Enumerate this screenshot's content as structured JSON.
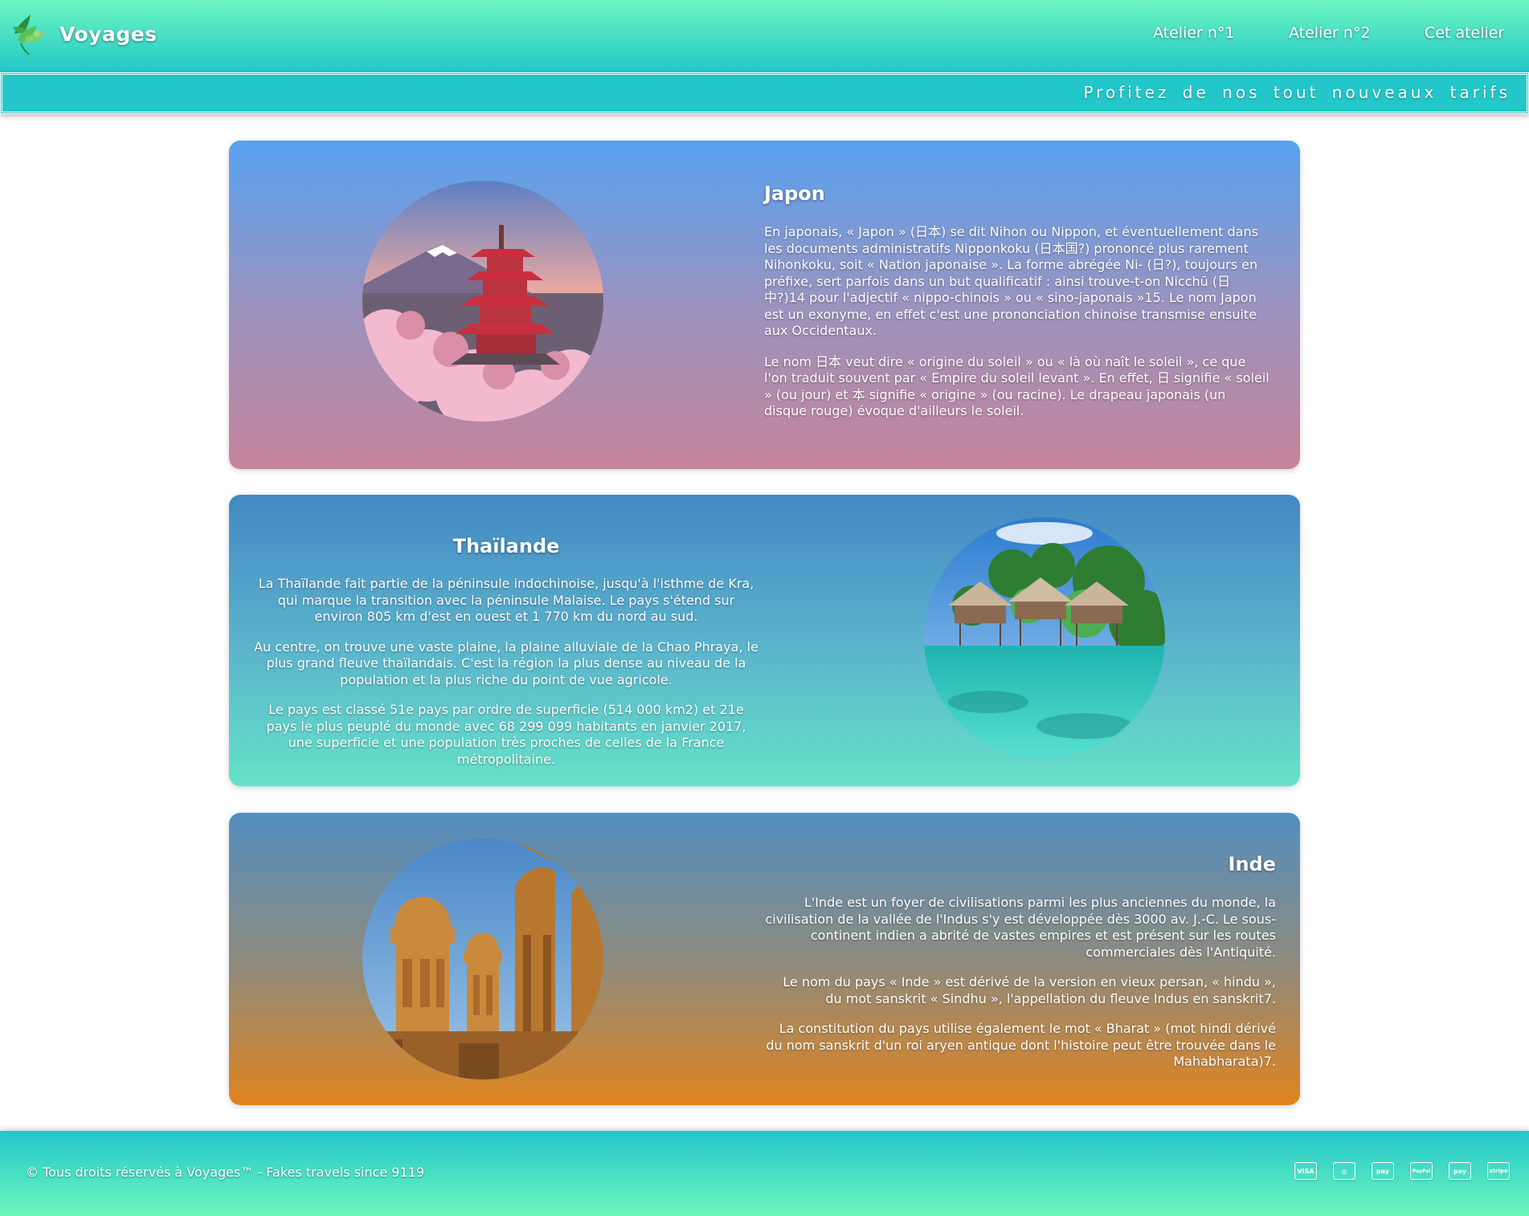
{
  "header": {
    "brand": "Voyages",
    "nav": [
      {
        "label": "Atelier n°1"
      },
      {
        "label": "Atelier n°2"
      },
      {
        "label": "Cet atelier"
      }
    ]
  },
  "banner": {
    "text": "Profitez de nos tout nouveaux tarifs"
  },
  "cards": [
    {
      "title": "Japon",
      "paragraphs": [
        "En japonais, « Japon » (日本) se dit Nihon ou Nippon, et éventuellement dans les documents administratifs Nipponkoku (日本国?) prononcé plus rarement Nihonkoku, soit « Nation japonaise ». La forme abrégée Ni- (日?), toujours en préfixe, sert parfois dans un but qualificatif : ainsi trouve-t-on Nicchū (日中?)14 pour l'adjectif « nippo-chinois » ou « sino-japonais »15. Le nom Japon est un exonyme, en effet c'est une prononciation chinoise transmise ensuite aux Occidentaux.",
        "Le nom 日本 veut dire « origine du soleil » ou « là où naît le soleil », ce que l'on traduit souvent par « Empire du soleil levant ». En effet, 日 signifie « soleil » (ou jour) et 本 signifie « origine » (ou racine). Le drapeau japonais (un disque rouge) évoque d'ailleurs le soleil."
      ]
    },
    {
      "title": "Thaïlande",
      "paragraphs": [
        "La Thaïlande fait partie de la péninsule indochinoise, jusqu'à l'isthme de Kra, qui marque la transition avec la péninsule Malaise. Le pays s'étend sur environ 805 km d'est en ouest et 1 770 km du nord au sud.",
        "Au centre, on trouve une vaste plaine, la plaine alluviale de la Chao Phraya, le plus grand fleuve thaïlandais. C'est la région la plus dense au niveau de la population et la plus riche du point de vue agricole.",
        "Le pays est classé 51e pays par ordre de superficie (514 000 km2) et 21e pays le plus peuplé du monde avec 68 299 099 habitants en janvier 2017, une superficie et une population très proches de celles de la France métropolitaine."
      ]
    },
    {
      "title": "Inde",
      "paragraphs": [
        "L'Inde est un foyer de civilisations parmi les plus anciennes du monde, la civilisation de la vallée de l'Indus s'y est développée dès 3000 av. J.-C. Le sous-continent indien a abrité de vastes empires et est présent sur les routes commerciales dès l'Antiquité.",
        "Le nom du pays « Inde » est dérivé de la version en vieux persan, « hindu », du mot sanskrit « Sindhu », l'appellation du fleuve Indus en sanskrit7.",
        "La constitution du pays utilise également le mot « Bharat » (mot hindi dérivé du nom sanskrit d'un roi aryen antique dont l'histoire peut être trouvée dans le Mahabharata)7."
      ]
    }
  ],
  "footer": {
    "copyright": "© Tous droits réservés à Voyages™ - Fakes travels since 9119",
    "payment_icons": [
      {
        "name": "visa",
        "label": "VISA"
      },
      {
        "name": "mastercard",
        "label": "◎"
      },
      {
        "name": "apple-pay",
        "label": "pay"
      },
      {
        "name": "paypal",
        "label": "PayPal"
      },
      {
        "name": "amazon-pay",
        "label": "pay"
      },
      {
        "name": "stripe",
        "label": "stripe"
      }
    ]
  },
  "colors": {
    "header_top": "#6df7c0",
    "header_bottom": "#23c6c9",
    "japon_top": "#57a2f0",
    "japon_bottom": "#c6849a",
    "thai_top": "#4388c3",
    "thai_bottom": "#64e2c8",
    "inde_top": "#548ec0",
    "inde_bottom": "#e0841f"
  }
}
